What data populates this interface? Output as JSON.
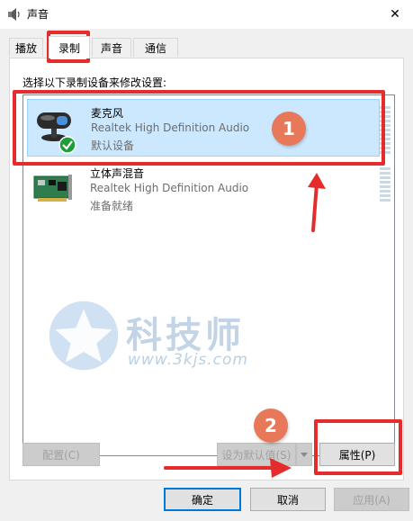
{
  "window": {
    "title": "声音",
    "close_glyph": "✕"
  },
  "tabs": [
    {
      "label": "播放"
    },
    {
      "label": "录制"
    },
    {
      "label": "声音"
    },
    {
      "label": "通信"
    }
  ],
  "panel": {
    "instruction": "选择以下录制设备来修改设置:",
    "devices": [
      {
        "name": "麦克风",
        "description": "Realtek High Definition Audio",
        "status": "默认设备",
        "icon": "microphone-icon",
        "default_check": "check-icon"
      },
      {
        "name": "立体声混音",
        "description": "Realtek High Definition Audio",
        "status": "准备就绪",
        "icon": "sound-card-icon"
      }
    ]
  },
  "buttons": {
    "configure": "配置(C)",
    "set_default": "设为默认值(S)",
    "properties": "属性(P)",
    "ok": "确定",
    "cancel": "取消",
    "apply": "应用(A)"
  },
  "annotations": {
    "step1": "1",
    "step2": "2",
    "accent_color": "#e52b2b",
    "badge_color": "#e8785a"
  },
  "watermark": {
    "title": "科技师",
    "url": "www.3kjs.com"
  }
}
